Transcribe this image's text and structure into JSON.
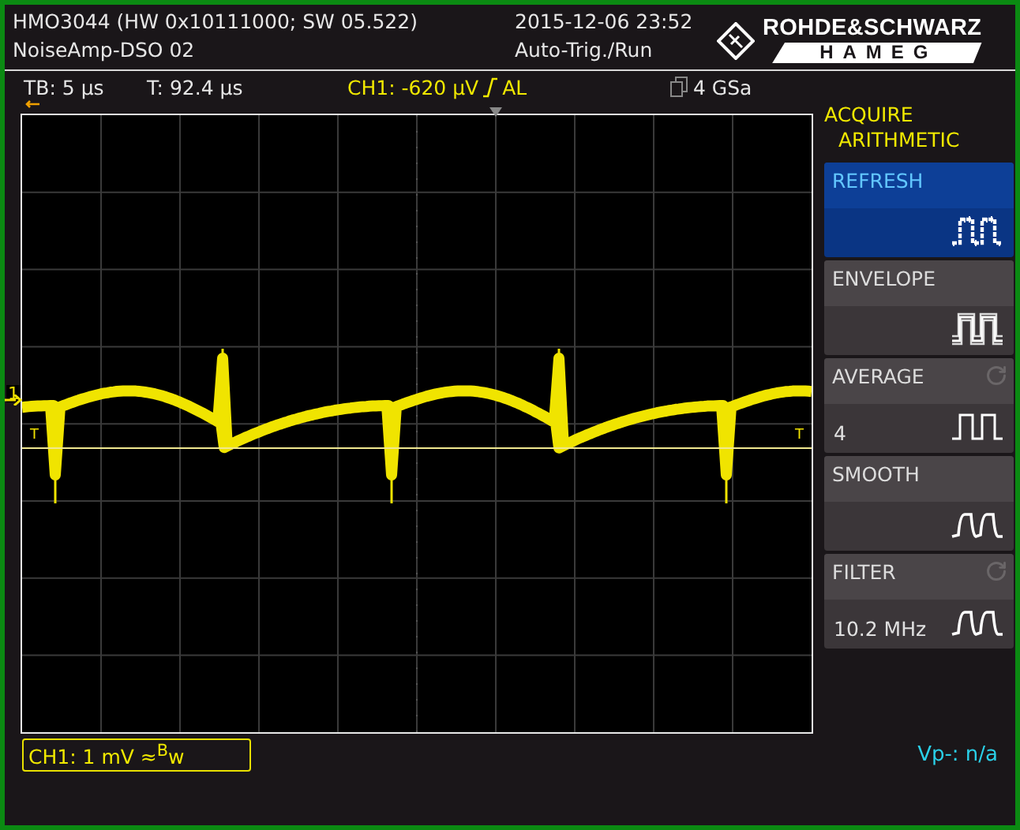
{
  "header": {
    "device": "HMO3044 (HW 0x10111000; SW 05.522)",
    "setup_name": "NoiseAmp-DSO 02",
    "timestamp": "2015-12-06 23:52",
    "run_state": "Auto-Trig./Run",
    "logo_top": "ROHDE&SCHWARZ",
    "logo_bottom": "HAMEG"
  },
  "info_bar": {
    "timebase": "TB: 5 µs",
    "trigger_time": "T: 92.4 µs",
    "trigger_level": "CH1: -620 µV",
    "trigger_mode": "AL",
    "sample_rate": "4 GSa"
  },
  "plot": {
    "channel_marker": "1",
    "trigger_marker_left": "T",
    "trigger_marker_right": "T"
  },
  "menu": {
    "title": "ACQUIRE",
    "subtitle": "ARITHMETIC",
    "items": [
      {
        "label": "REFRESH",
        "selected": true,
        "kind": "noisy",
        "adjustable": false
      },
      {
        "label": "ENVELOPE",
        "selected": false,
        "kind": "envelope",
        "adjustable": false
      },
      {
        "label": "AVERAGE",
        "selected": false,
        "kind": "clean",
        "adjustable": true,
        "value": "4"
      },
      {
        "label": "SMOOTH",
        "selected": false,
        "kind": "smooth",
        "adjustable": false
      },
      {
        "label": "FILTER",
        "selected": false,
        "kind": "smooth",
        "adjustable": true,
        "value": "10.2 MHz"
      }
    ]
  },
  "footer": {
    "channel_setting": "CH1: 1 mV ≈$^{B}$w",
    "measurement": "Vp-: n/a"
  }
}
